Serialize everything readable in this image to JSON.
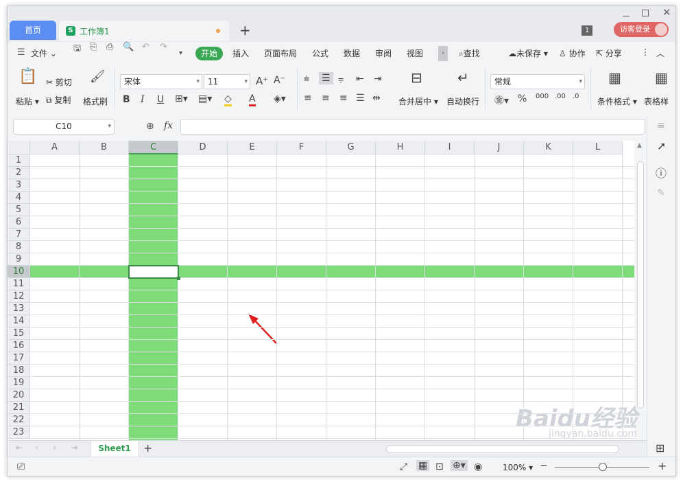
{
  "titlebar": {
    "home_tab": "首页",
    "doc_tab": "工作簿1",
    "doc_icon_letter": "S",
    "add_tab": "+",
    "window_badge": "1",
    "login": "访客登录"
  },
  "menubar": {
    "file": "文件",
    "tabs": [
      "开始",
      "插入",
      "页面布局",
      "公式",
      "数据",
      "审阅",
      "视图"
    ],
    "search": "查找",
    "unsaved": "未保存",
    "collab": "协作",
    "share": "分享"
  },
  "toolbar": {
    "paste": "粘贴",
    "cut": "剪切",
    "copy": "复制",
    "format_painter": "格式刷",
    "font_name": "宋体",
    "font_size": "11",
    "merge_center": "合并居中",
    "wrap_text": "自动换行",
    "number_format": "常规",
    "conditional_format": "条件格式",
    "table_style": "表格样"
  },
  "formula_bar": {
    "name_box": "C10",
    "fx": "fx",
    "value": ""
  },
  "grid": {
    "columns": [
      "A",
      "B",
      "C",
      "D",
      "E",
      "F",
      "G",
      "H",
      "I",
      "J",
      "K",
      "L"
    ],
    "rows": [
      "1",
      "2",
      "3",
      "4",
      "5",
      "6",
      "7",
      "8",
      "9",
      "10",
      "11",
      "12",
      "13",
      "14",
      "15",
      "16",
      "17",
      "18",
      "19",
      "20",
      "21",
      "22",
      "23"
    ],
    "selected_column": "C",
    "selected_row": "10",
    "highlight_color": "#7fdc7a"
  },
  "sheets": {
    "tabs": [
      "Sheet1"
    ],
    "add": "+"
  },
  "status": {
    "zoom": "100%"
  },
  "watermark": {
    "brand": "Baidu经验",
    "url": "jingyan.baidu.com"
  }
}
